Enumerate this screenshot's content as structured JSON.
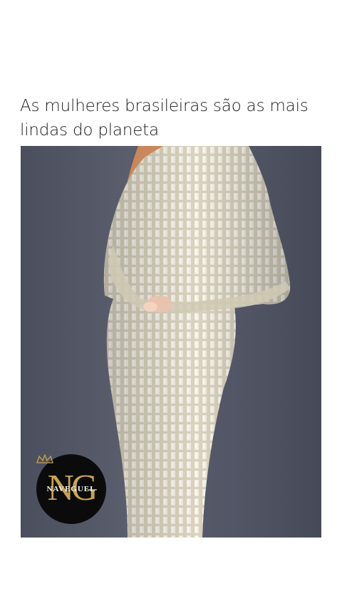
{
  "post": {
    "caption": "As mulheres brasileiras são as mais lindas do planeta"
  },
  "photo": {
    "description_icon": "dress-photo"
  },
  "logo": {
    "initials": "NG",
    "brand": "NAVEGUEL",
    "colors": {
      "background": "#0b0b0b",
      "gold": "#c9a44e"
    }
  }
}
